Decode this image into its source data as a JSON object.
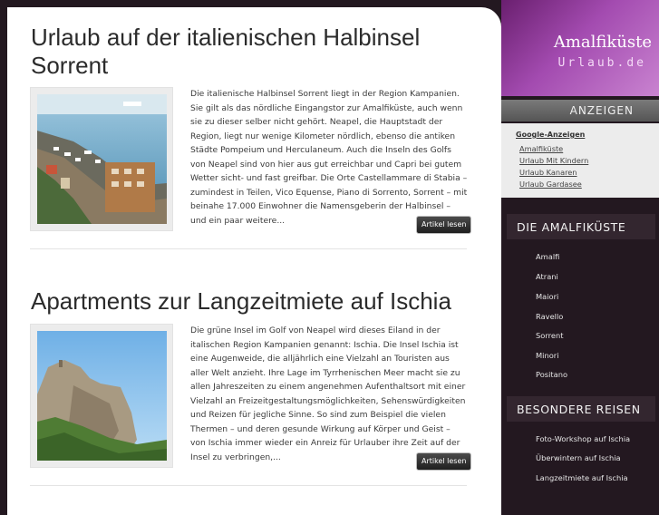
{
  "posts": [
    {
      "title_line1": "Urlaub auf der italienischen Halbinsel",
      "title_line2": "Sorrent",
      "excerpt": "Die italienische Halbinsel Sorrent liegt in der Region Kampanien. Sie gilt als das nördliche Eingangstor zur Amalfiküste, auch wenn sie zu dieser selber nicht gehört. Neapel, die Hauptstadt der Region, liegt nur wenige Kilometer nördlich, ebenso die antiken Städte Pompeium und Herculaneum. Auch die Inseln des Golfs von Neapel sind von hier aus gut erreichbar und Capri bei gutem Wetter sicht- und fast greifbar. Die Orte Castellammare di Stabia – zumindest in Teilen, Vico Equense, Piano di Sorrento, Sorrent – mit beinahe 17.000 Einwohner die Namensgeberin der Halbinsel – und ein paar weitere...",
      "read_more": "Artikel lesen"
    },
    {
      "title_line1": "Apartments zur Langzeitmiete auf Ischia",
      "excerpt": "Die grüne Insel im Golf von Neapel wird dieses Eiland in der italischen Region Kampanien genannt: Ischia. Die Insel Ischia ist eine Augenweide, die alljährlich eine Vielzahl an Touristen aus aller Welt anzieht. Ihre Lage im Tyrrhenischen Meer macht sie zu allen Jahreszeiten zu einem angenehmen Aufenthaltsort mit einer Vielzahl an Freizeitgestaltungsmöglichkeiten, Sehenswürdigkeiten und Reizen für jegliche Sinne. So sind zum Beispiel die vielen Thermen – und deren gesunde Wirkung auf Körper und Geist – von Ischia immer wieder ein Anreiz für Urlauber ihre Zeit auf der Insel zu verbringen,...",
      "read_more": "Artikel lesen"
    }
  ],
  "sidebar": {
    "logo_line1": "Amalfiküste",
    "logo_line2": "Urlaub.de",
    "ads_title": "ANZEIGEN",
    "google_ads_heading": "Google-Anzeigen",
    "ads_links": [
      "Amalfiküste",
      "Urlaub Mit Kindern",
      "Urlaub Kanaren",
      "Urlaub Gardasee"
    ],
    "section1_title": "DIE AMALFIKÜSTE",
    "section1_links": [
      "Amalfi",
      "Atrani",
      "Maiori",
      "Ravello",
      "Sorrent",
      "Minori",
      "Positano"
    ],
    "section2_title": "BESONDERE REISEN",
    "section2_links": [
      "Foto-Workshop auf Ischia",
      "Überwintern auf Ischia",
      "Langzeitmiete auf Ischia"
    ]
  }
}
